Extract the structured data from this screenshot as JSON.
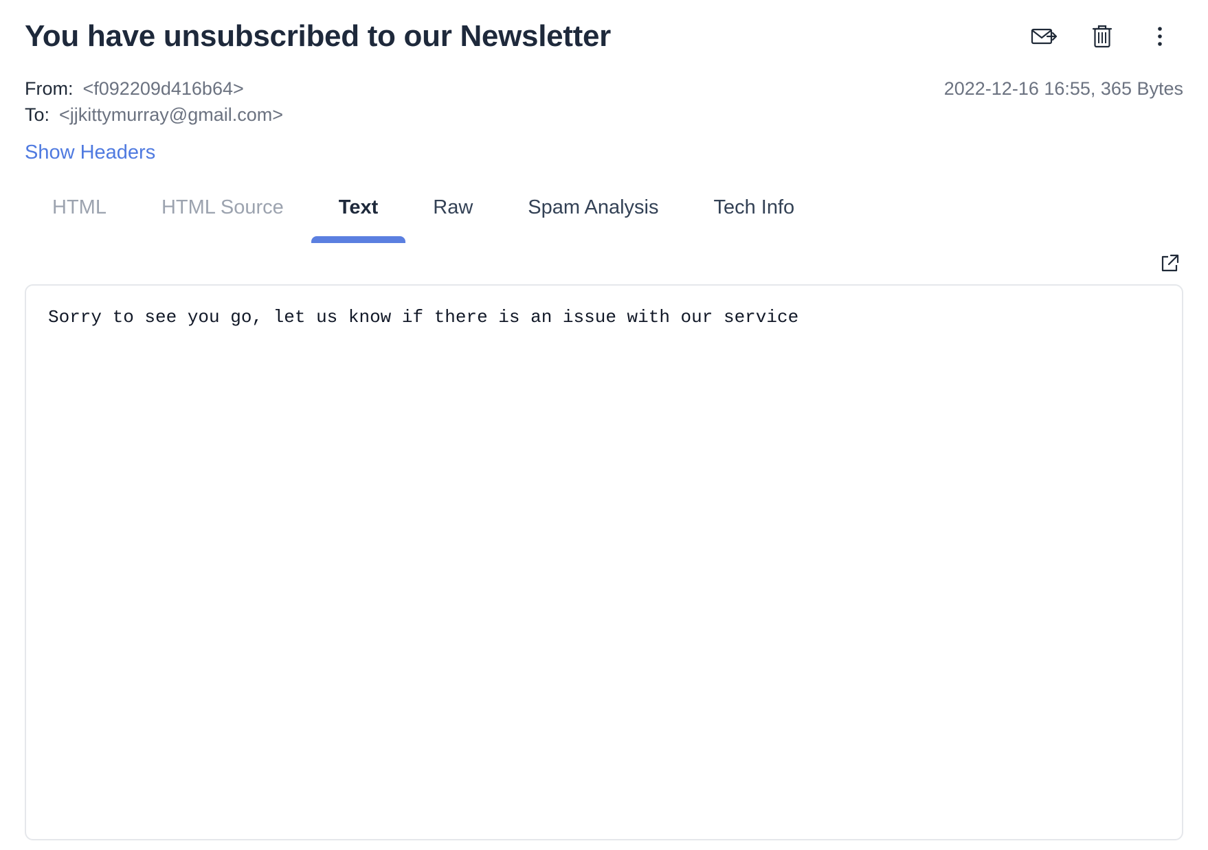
{
  "email": {
    "subject": "You have unsubscribed to our Newsletter",
    "from_label": "From:",
    "from_value": "<f092209d416b64>",
    "to_label": "To:",
    "to_value": "<jjkittymurray@gmail.com>",
    "date_size": "2022-12-16 16:55, 365 Bytes",
    "show_headers": "Show Headers",
    "body_text": "Sorry to see you go, let us know if there is an issue with our service"
  },
  "actions": [
    {
      "icon": "forward-mail-icon"
    },
    {
      "icon": "trash-icon"
    },
    {
      "icon": "more-vertical-icon"
    }
  ],
  "tabs": [
    {
      "label": "HTML",
      "state": "disabled"
    },
    {
      "label": "HTML Source",
      "state": "disabled"
    },
    {
      "label": "Text",
      "state": "active"
    },
    {
      "label": "Raw",
      "state": "normal"
    },
    {
      "label": "Spam Analysis",
      "state": "normal"
    },
    {
      "label": "Tech Info",
      "state": "normal"
    }
  ],
  "colors": {
    "accent": "#5b7fe0",
    "link": "#4f7ae0",
    "title": "#1e293b",
    "muted": "#9ca3af"
  }
}
